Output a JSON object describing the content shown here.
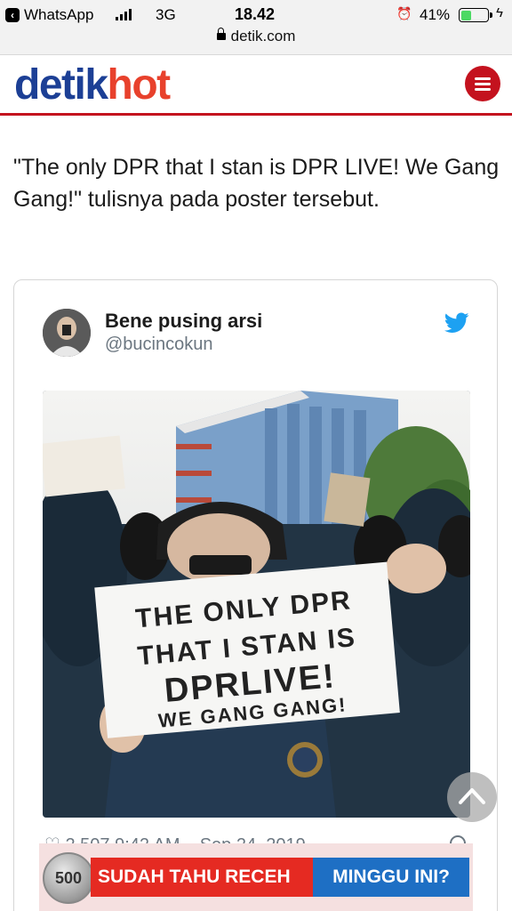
{
  "status_bar": {
    "back_app": "WhatsApp",
    "network": "3G",
    "time": "18.42",
    "battery_pct": "41%",
    "battery_level": 0.41,
    "url": "detik.com"
  },
  "header": {
    "logo_part1": "detik",
    "logo_part2": "hot",
    "brand_blue": "#1c3f95",
    "brand_red": "#e8412c"
  },
  "article": {
    "paragraph": "\"The only DPR that I stan is DPR LIVE! We Gang Gang!\" tulisnya pada poster tersebut."
  },
  "tweet": {
    "name": "Bene pusing arsi",
    "handle": "@bucincokun",
    "sign_lines": [
      "THE ONLY DPR",
      "THAT I STAN IS",
      "DPRLIVE!",
      "WE GANG GANG!"
    ],
    "meta_partial": "2.507   9:42 AM – Sep 24, 2019"
  },
  "ad": {
    "coin_label": "500",
    "red_text": "SUDAH TAHU RECEH",
    "blue_text": "MINGGU INI?"
  },
  "icons": [
    "back-icon",
    "signal-icon",
    "alarm-icon",
    "battery-icon",
    "charging-icon",
    "lock-icon",
    "menu-icon",
    "twitter-bird-icon",
    "heart-icon",
    "info-icon",
    "chevron-up-icon"
  ]
}
